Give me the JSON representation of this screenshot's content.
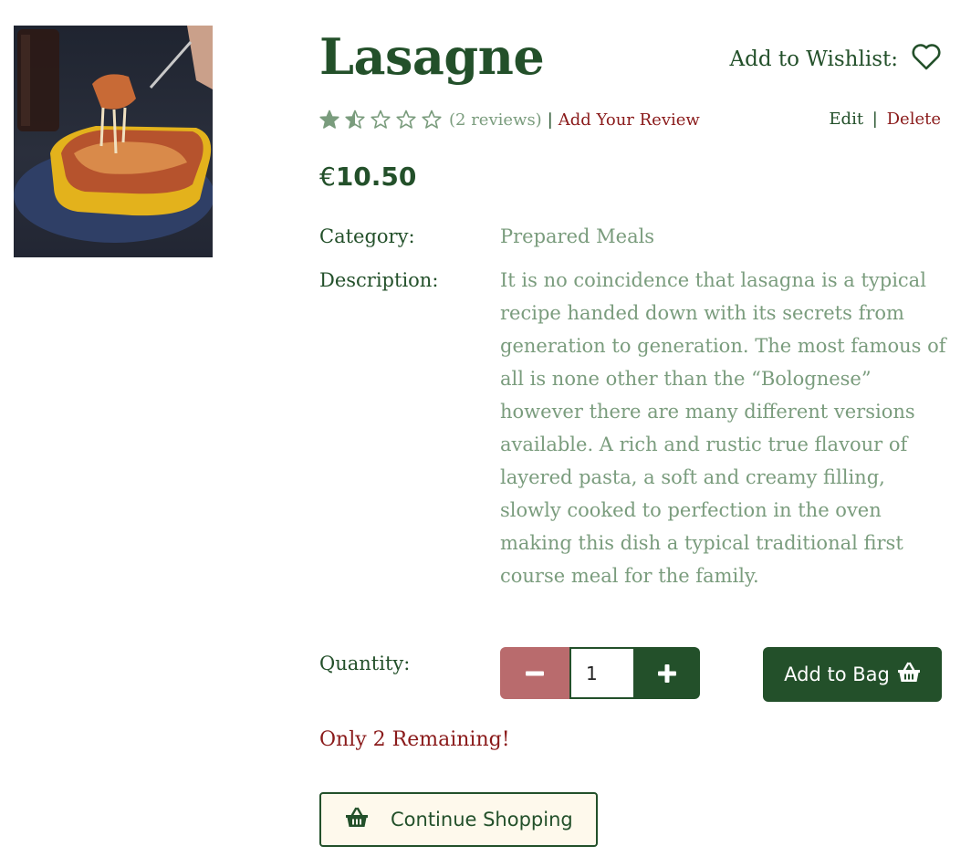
{
  "product": {
    "title": "Lasagne",
    "image_alt": "Lasagne",
    "price_currency": "€",
    "price_amount": "10.50",
    "category_label": "Category:",
    "category_value": "Prepared Meals",
    "description_label": "Description:",
    "description": "It is no coincidence that lasagna is a typical recipe handed down with its secrets from generation to generation. The most famous of all is none other than the “Bolognese” however there are many different versions available. A rich and rustic true flavour of layered pasta, a soft and creamy filling, slowly cooked to perfection in the oven making this dish a typical traditional first course meal for the family."
  },
  "wishlist": {
    "label": "Add to Wishlist:",
    "icon": "heart-outline-icon"
  },
  "rating": {
    "value": 1.5,
    "max": 5,
    "reviews_text": "(2 reviews)",
    "separator": "|",
    "add_review_label": "Add Your Review",
    "star_color": "#7a9c7d"
  },
  "admin": {
    "edit_label": "Edit",
    "separator": "|",
    "delete_label": "Delete"
  },
  "quantity": {
    "label": "Quantity:",
    "value": "1"
  },
  "buttons": {
    "add_to_bag_label": "Add to Bag",
    "continue_shopping_label": "Continue Shopping"
  },
  "stock": {
    "remaining_text": "Only 2 Remaining!"
  },
  "colors": {
    "brand_green": "#23502a",
    "muted_green": "#7a9c7d",
    "accent_red": "#8a1a1a",
    "minus_button": "#b96b6d",
    "continue_bg": "#fef9ec"
  }
}
